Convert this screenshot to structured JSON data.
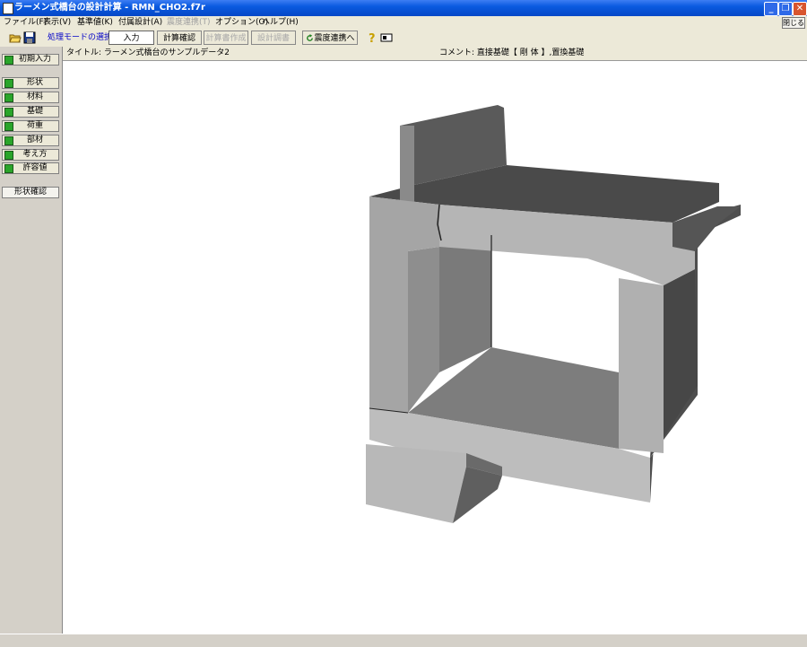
{
  "window": {
    "title": "ラーメン式橋台の設計計算 - RMN_CHO2.f7r",
    "min_glyph": "_",
    "max_glyph": "❐",
    "close_glyph": "✕"
  },
  "menu": {
    "items": [
      "ファイル(F)",
      "表示(V)",
      "基準値(K)",
      "付属設計(A)",
      "震度連携(T)",
      "オプション(O)",
      "ヘルプ(H)"
    ],
    "close_label": "閉じる"
  },
  "toolbar": {
    "mode_label": "処理モードの選択",
    "buttons": [
      "入力",
      "計算確認",
      "計算書作成",
      "設計調書",
      "震度連携へ"
    ],
    "icons": [
      "open-folder-icon",
      "save-disk-icon",
      "refresh-icon",
      "help-icon",
      "card-icon"
    ]
  },
  "sidebar": {
    "initial": "初期入力",
    "items": [
      "形状",
      "材料",
      "基礎",
      "荷重",
      "部材",
      "考え方",
      "許容値"
    ],
    "confirm": "形状確認"
  },
  "info": {
    "title": "タイトル: ラーメン式橋台のサンプルデータ2",
    "comment": "コメント: 直接基礎【 剛 体 】,置換基礎"
  },
  "colors": {
    "titlebar": "#0a5ae0",
    "mode_label": "#0000c8",
    "status_check": "#2aa52a"
  }
}
